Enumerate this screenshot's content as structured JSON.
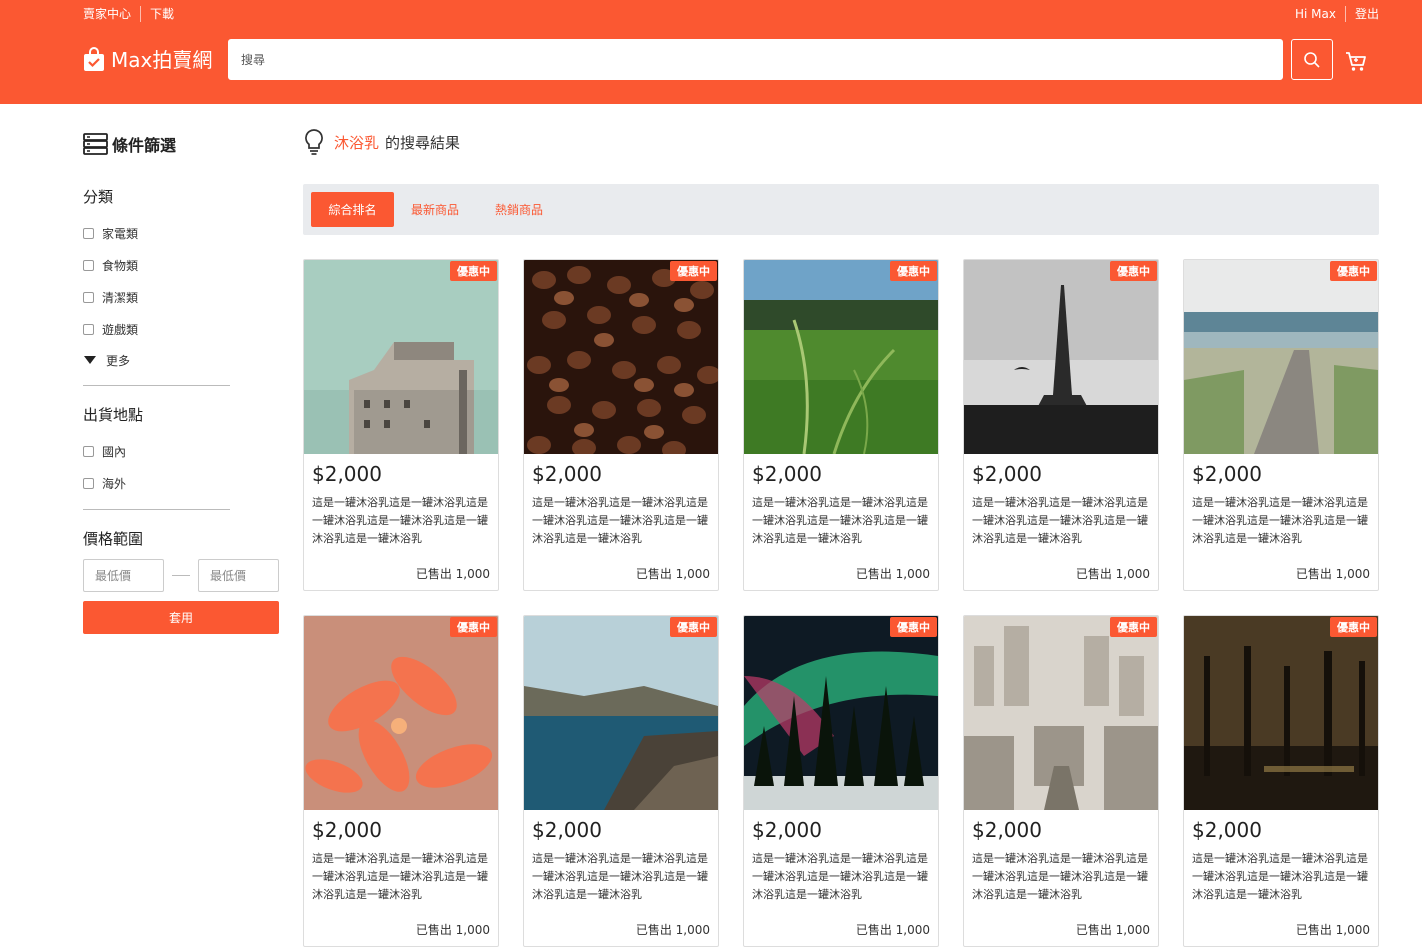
{
  "header": {
    "seller_center": "賣家中心",
    "download": "下載",
    "greeting": "Hi Max",
    "logout": "登出",
    "logo_text": "Max拍賣網",
    "search_placeholder": "搜尋",
    "brand_color": "#fb5832"
  },
  "sidebar": {
    "filter_title": "條件篩選",
    "category": {
      "title": "分類",
      "items": [
        "家電類",
        "食物類",
        "清潔類",
        "遊戲類"
      ],
      "more": "更多"
    },
    "shipping": {
      "title": "出貨地點",
      "items": [
        "國內",
        "海外"
      ]
    },
    "price": {
      "title": "價格範圍",
      "min_placeholder": "最低價",
      "max_placeholder": "最低價",
      "apply": "套用"
    }
  },
  "results": {
    "keyword": "沐浴乳",
    "suffix": "的搜尋結果"
  },
  "sort_tabs": [
    {
      "label": "綜合排名",
      "active": true
    },
    {
      "label": "最新商品",
      "active": false
    },
    {
      "label": "熱銷商品",
      "active": false
    }
  ],
  "products": [
    {
      "badge": "優惠中",
      "price": "$2,000",
      "desc": "這是一罐沐浴乳這是一罐沐浴乳這是一罐沐浴乳這是一罐沐浴乳這是一罐沐浴乳這是一罐沐浴乳",
      "sold": "已售出 1,000",
      "image": "tower"
    },
    {
      "badge": "優惠中",
      "price": "$2,000",
      "desc": "這是一罐沐浴乳這是一罐沐浴乳這是一罐沐浴乳這是一罐沐浴乳這是一罐沐浴乳這是一罐沐浴乳",
      "sold": "已售出 1,000",
      "image": "coffee"
    },
    {
      "badge": "優惠中",
      "price": "$2,000",
      "desc": "這是一罐沐浴乳這是一罐沐浴乳這是一罐沐浴乳這是一罐沐浴乳這是一罐沐浴乳這是一罐沐浴乳",
      "sold": "已售出 1,000",
      "image": "grass"
    },
    {
      "badge": "優惠中",
      "price": "$2,000",
      "desc": "這是一罐沐浴乳這是一罐沐浴乳這是一罐沐浴乳這是一罐沐浴乳這是一罐沐浴乳這是一罐沐浴乳",
      "sold": "已售出 1,000",
      "image": "eiffel"
    },
    {
      "badge": "優惠中",
      "price": "$2,000",
      "desc": "這是一罐沐浴乳這是一罐沐浴乳這是一罐沐浴乳這是一罐沐浴乳這是一罐沐浴乳這是一罐沐浴乳",
      "sold": "已售出 1,000",
      "image": "boardwalk"
    },
    {
      "badge": "優惠中",
      "price": "$2,000",
      "desc": "這是一罐沐浴乳這是一罐沐浴乳這是一罐沐浴乳這是一罐沐浴乳這是一罐沐浴乳這是一罐沐浴乳",
      "sold": "已售出 1,000",
      "image": "flower"
    },
    {
      "badge": "優惠中",
      "price": "$2,000",
      "desc": "這是一罐沐浴乳這是一罐沐浴乳這是一罐沐浴乳這是一罐沐浴乳這是一罐沐浴乳這是一罐沐浴乳",
      "sold": "已售出 1,000",
      "image": "coast"
    },
    {
      "badge": "優惠中",
      "price": "$2,000",
      "desc": "這是一罐沐浴乳這是一罐沐浴乳這是一罐沐浴乳這是一罐沐浴乳這是一罐沐浴乳這是一罐沐浴乳",
      "sold": "已售出 1,000",
      "image": "aurora"
    },
    {
      "badge": "優惠中",
      "price": "$2,000",
      "desc": "這是一罐沐浴乳這是一罐沐浴乳這是一罐沐浴乳這是一罐沐浴乳這是一罐沐浴乳這是一罐沐浴乳",
      "sold": "已售出 1,000",
      "image": "city"
    },
    {
      "badge": "優惠中",
      "price": "$2,000",
      "desc": "這是一罐沐浴乳這是一罐沐浴乳這是一罐沐浴乳這是一罐沐浴乳這是一罐沐浴乳這是一罐沐浴乳",
      "sold": "已售出 1,000",
      "image": "forest"
    }
  ]
}
